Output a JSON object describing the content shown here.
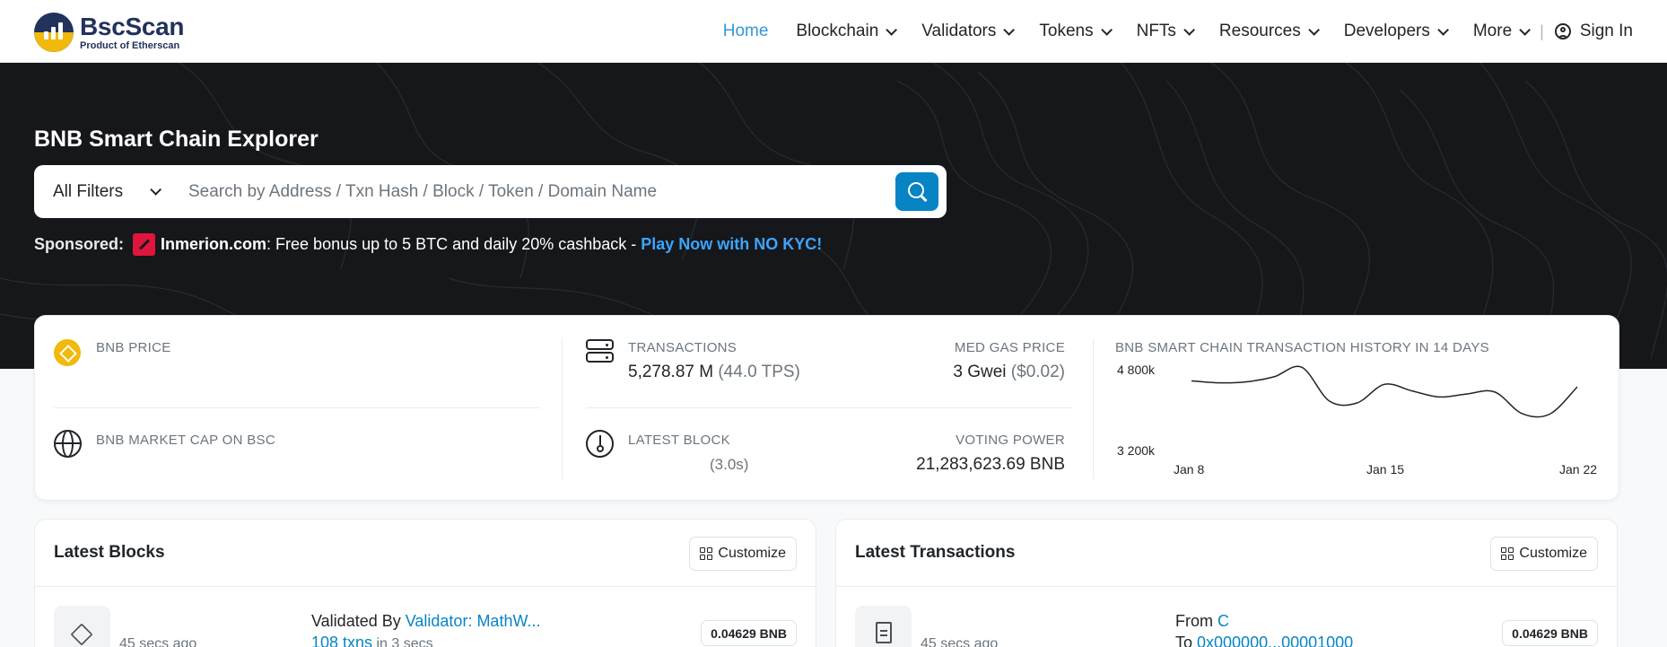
{
  "header": {
    "logo_title": "BscScan",
    "logo_sub": "Product of Etherscan",
    "nav": [
      {
        "label": "Home"
      },
      {
        "label": "Blockchain"
      },
      {
        "label": "Validators"
      },
      {
        "label": "Tokens"
      },
      {
        "label": "NFTs"
      },
      {
        "label": "Resources"
      },
      {
        "label": "Developers"
      },
      {
        "label": "More"
      }
    ],
    "separator": "|",
    "sign_in": "Sign In"
  },
  "hero": {
    "title": "BNB Smart Chain Explorer",
    "filter_label": "All Filters",
    "search_placeholder": "Search by Address / Txn Hash / Block / Token / Domain Name",
    "sponsored_label": "Sponsored:",
    "sponsor_brand": "Inmerion.com",
    "sponsor_text": ": Free bonus up to 5 BTC and daily 20% cashback - ",
    "sponsor_link": "Play Now with NO KYC!"
  },
  "stats": {
    "bnb_price_label": "BNB PRICE",
    "market_cap_label": "BNB MARKET CAP ON BSC",
    "transactions_label": "TRANSACTIONS",
    "transactions_value": "5,278.87 M",
    "transactions_tps": "(44.0 TPS)",
    "gas_label": "MED GAS PRICE",
    "gas_value": "3 Gwei",
    "gas_usd": "($0.02)",
    "latest_block_label": "LATEST BLOCK",
    "latest_block_time": "(3.0s)",
    "voting_power_label": "VOTING POWER",
    "voting_power_value": "21,283,623.69 BNB"
  },
  "chart_data": {
    "type": "line",
    "title": "BNB SMART CHAIN TRANSACTION HISTORY IN 14 DAYS",
    "x": [
      "Jan 8",
      "Jan 9",
      "Jan 10",
      "Jan 11",
      "Jan 12",
      "Jan 13",
      "Jan 14",
      "Jan 15",
      "Jan 16",
      "Jan 17",
      "Jan 18",
      "Jan 19",
      "Jan 20",
      "Jan 21",
      "Jan 22"
    ],
    "values": [
      4580,
      4540,
      4560,
      4660,
      4850,
      4180,
      4140,
      4510,
      4380,
      4260,
      4320,
      4360,
      3930,
      3920,
      4460
    ],
    "ytick_labels": [
      "4 800k",
      "3 200k"
    ],
    "xtick_labels": [
      "Jan 8",
      "Jan 15",
      "Jan 22"
    ],
    "ylim": [
      3200,
      4800
    ],
    "color": "#212529"
  },
  "blocks": {
    "title": "Latest Blocks",
    "customize": "Customize",
    "item": {
      "age": "45 secs ago",
      "validated_prefix": "Validated By ",
      "validator": "Validator: MathW...",
      "txns": "108 txns",
      "txns_suffix": " in 3 secs",
      "reward": "0.04629 BNB"
    }
  },
  "transactions": {
    "title": "Latest Transactions",
    "customize": "Customize",
    "item": {
      "age": "45 secs ago",
      "from_prefix": "From ",
      "from_addr": "С",
      "to_prefix": "To ",
      "to_addr": "0x000000...00001000",
      "value": "0.04629 BNB"
    }
  }
}
